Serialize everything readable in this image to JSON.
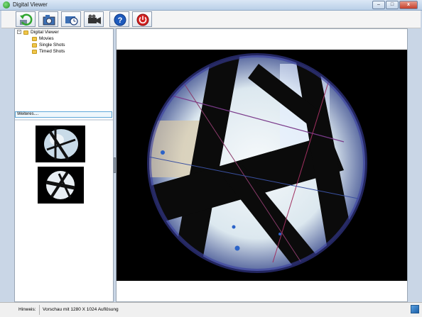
{
  "window": {
    "title": "Digital Viewer",
    "minimize_label": "–",
    "maximize_label": "□",
    "close_label": "x"
  },
  "toolbar": {
    "buttons": [
      {
        "name": "refresh-button",
        "icon": "refresh-icon"
      },
      {
        "name": "capture-photo-button",
        "icon": "camera-icon"
      },
      {
        "name": "timed-capture-button",
        "icon": "timer-icon"
      },
      {
        "name": "video-record-button",
        "icon": "video-camera-icon"
      },
      {
        "name": "help-button",
        "icon": "help-icon",
        "label": "?"
      },
      {
        "name": "power-button",
        "icon": "power-icon"
      }
    ]
  },
  "sidebar": {
    "tree": {
      "root": "Digital Viewer",
      "expander": "-",
      "children": [
        "Movies",
        "Single Shots",
        "Timed Shots"
      ]
    },
    "more_button": "Weiteres...."
  },
  "statusbar": {
    "label": "Hinweis:",
    "text": "Vorschau mit 1280 X 1024 Auflösung"
  },
  "colors": {
    "titlebar": "#c6d8ee",
    "accent": "#5fa8d8",
    "help_blue": "#1e5bbd",
    "power_red": "#d32222"
  }
}
